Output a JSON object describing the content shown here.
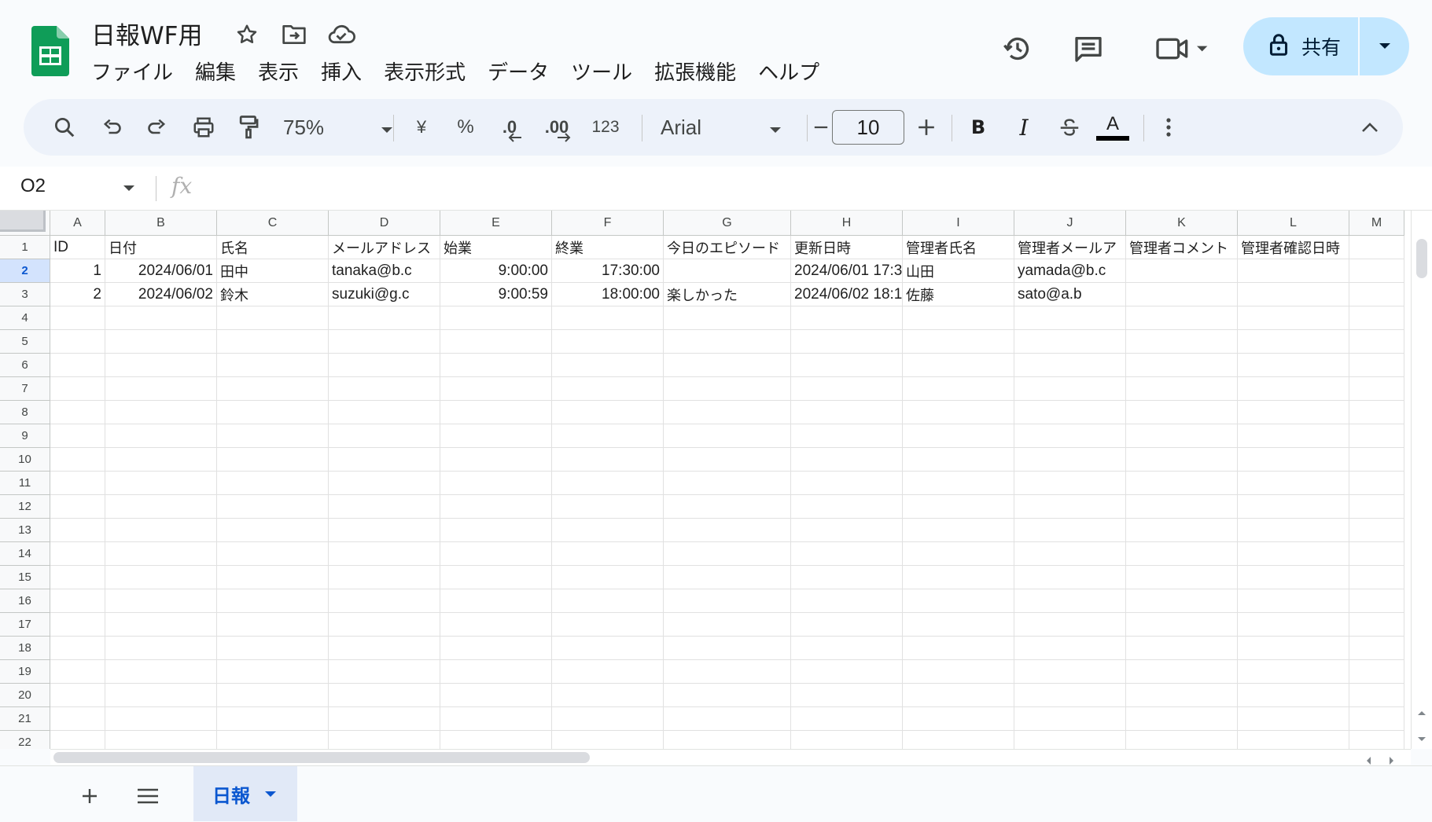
{
  "app": {
    "title": "日報WF用",
    "icons": {
      "logo": "sheets-logo-icon",
      "star": "star-icon",
      "move": "move-to-folder-icon",
      "cloud": "cloud-saved-icon"
    }
  },
  "menu": [
    "ファイル",
    "編集",
    "表示",
    "挿入",
    "表示形式",
    "データ",
    "ツール",
    "拡張機能",
    "ヘルプ"
  ],
  "header": {
    "share_label": "共有",
    "accent": "#c2e7ff"
  },
  "toolbar": {
    "zoom": "75%",
    "currency": "¥",
    "percent": "%",
    "dec_decrease": ".0",
    "dec_increase": ".00",
    "number_format": "123",
    "font": "Arial",
    "font_size": "10",
    "bold": "B",
    "italic": "I",
    "text_color": "A"
  },
  "formula_bar": {
    "name_box": "O2",
    "fx": "fx",
    "value": ""
  },
  "grid": {
    "columns": [
      "A",
      "B",
      "C",
      "D",
      "E",
      "F",
      "G",
      "H",
      "I",
      "J",
      "K",
      "L",
      "M"
    ],
    "rows": [
      "1",
      "2",
      "3",
      "4",
      "5",
      "6",
      "7",
      "8",
      "9",
      "10",
      "11",
      "12",
      "13",
      "14",
      "15",
      "16",
      "17",
      "18",
      "19",
      "20",
      "21",
      "22"
    ],
    "selected_row": "2",
    "header_row": [
      "ID",
      "日付",
      "氏名",
      "メールアドレス",
      "始業",
      "終業",
      "今日のエピソード",
      "更新日時",
      "管理者氏名",
      "管理者メールア",
      "管理者コメント",
      "管理者確認日時",
      ""
    ],
    "data_rows": [
      [
        "1",
        "2024/06/01",
        "田中",
        "tanaka@b.c",
        "9:00:00",
        "17:30:00",
        "",
        "2024/06/01 17:3",
        "山田",
        "yamada@b.c",
        "",
        "",
        ""
      ],
      [
        "2",
        "2024/06/02",
        "鈴木",
        "suzuki@g.c",
        "9:00:59",
        "18:00:00",
        "楽しかった",
        "2024/06/02 18:1",
        "佐藤",
        "sato@a.b",
        "",
        "",
        ""
      ]
    ]
  },
  "sheets": {
    "active": "日報"
  }
}
